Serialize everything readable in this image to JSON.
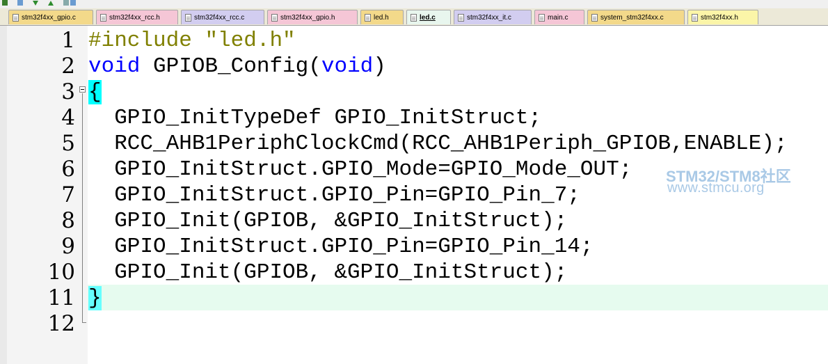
{
  "tabs": [
    {
      "label": "stm32f4xx_gpio.c",
      "color": "#f3d98a",
      "active": false
    },
    {
      "label": "stm32f4xx_rcc.h",
      "color": "#f5c6d6",
      "active": false
    },
    {
      "label": "stm32f4xx_rcc.c",
      "color": "#d2cdf0",
      "active": false
    },
    {
      "label": "stm32f4xx_gpio.h",
      "color": "#f5c6d6",
      "active": false
    },
    {
      "label": "led.h",
      "color": "#f3d98a",
      "active": false
    },
    {
      "label": "led.c",
      "color": "#e8f6ee",
      "active": true
    },
    {
      "label": "stm32f4xx_it.c",
      "color": "#d2cdf0",
      "active": false
    },
    {
      "label": "main.c",
      "color": "#f5c6d6",
      "active": false
    },
    {
      "label": "system_stm32f4xx.c",
      "color": "#f3d98a",
      "active": false
    },
    {
      "label": "stm32f4xx.h",
      "color": "#fbf5a8",
      "active": false
    }
  ],
  "editor": {
    "line_numbers": [
      "1",
      "2",
      "3",
      "4",
      "5",
      "6",
      "7",
      "8",
      "9",
      "10",
      "11",
      "12"
    ],
    "lines": [
      "#include \"led.h\"",
      "void GPIOB_Config(void)",
      "{",
      "  GPIO_InitTypeDef GPIO_InitStruct;",
      "  RCC_AHB1PeriphClockCmd(RCC_AHB1Periph_GPIOB,ENABLE);",
      "  GPIO_InitStruct.GPIO_Mode=GPIO_Mode_OUT;",
      "  GPIO_InitStruct.GPIO_Pin=GPIO_Pin_7;",
      "  GPIO_Init(GPIOB, &GPIO_InitStruct);",
      "  GPIO_InitStruct.GPIO_Pin=GPIO_Pin_14;",
      "  GPIO_Init(GPIOB, &GPIO_InitStruct);",
      "}",
      ""
    ],
    "tokens": {
      "pre": "#include",
      "str": "\"led.h\"",
      "kw_void": "void",
      "fn": "GPIOB_Config(",
      "kw_void2": "void",
      "close": ")",
      "open_brace": "{",
      "close_brace": "}"
    },
    "current_line": 11,
    "colors": {
      "keyword": "#0000ff",
      "preprocessor": "#808000",
      "brace_match": "#00ffff",
      "current_line": "#e6fbef"
    }
  },
  "watermark": {
    "line1": "STM32/STM8社区",
    "line2": "www.stmcu.org"
  }
}
